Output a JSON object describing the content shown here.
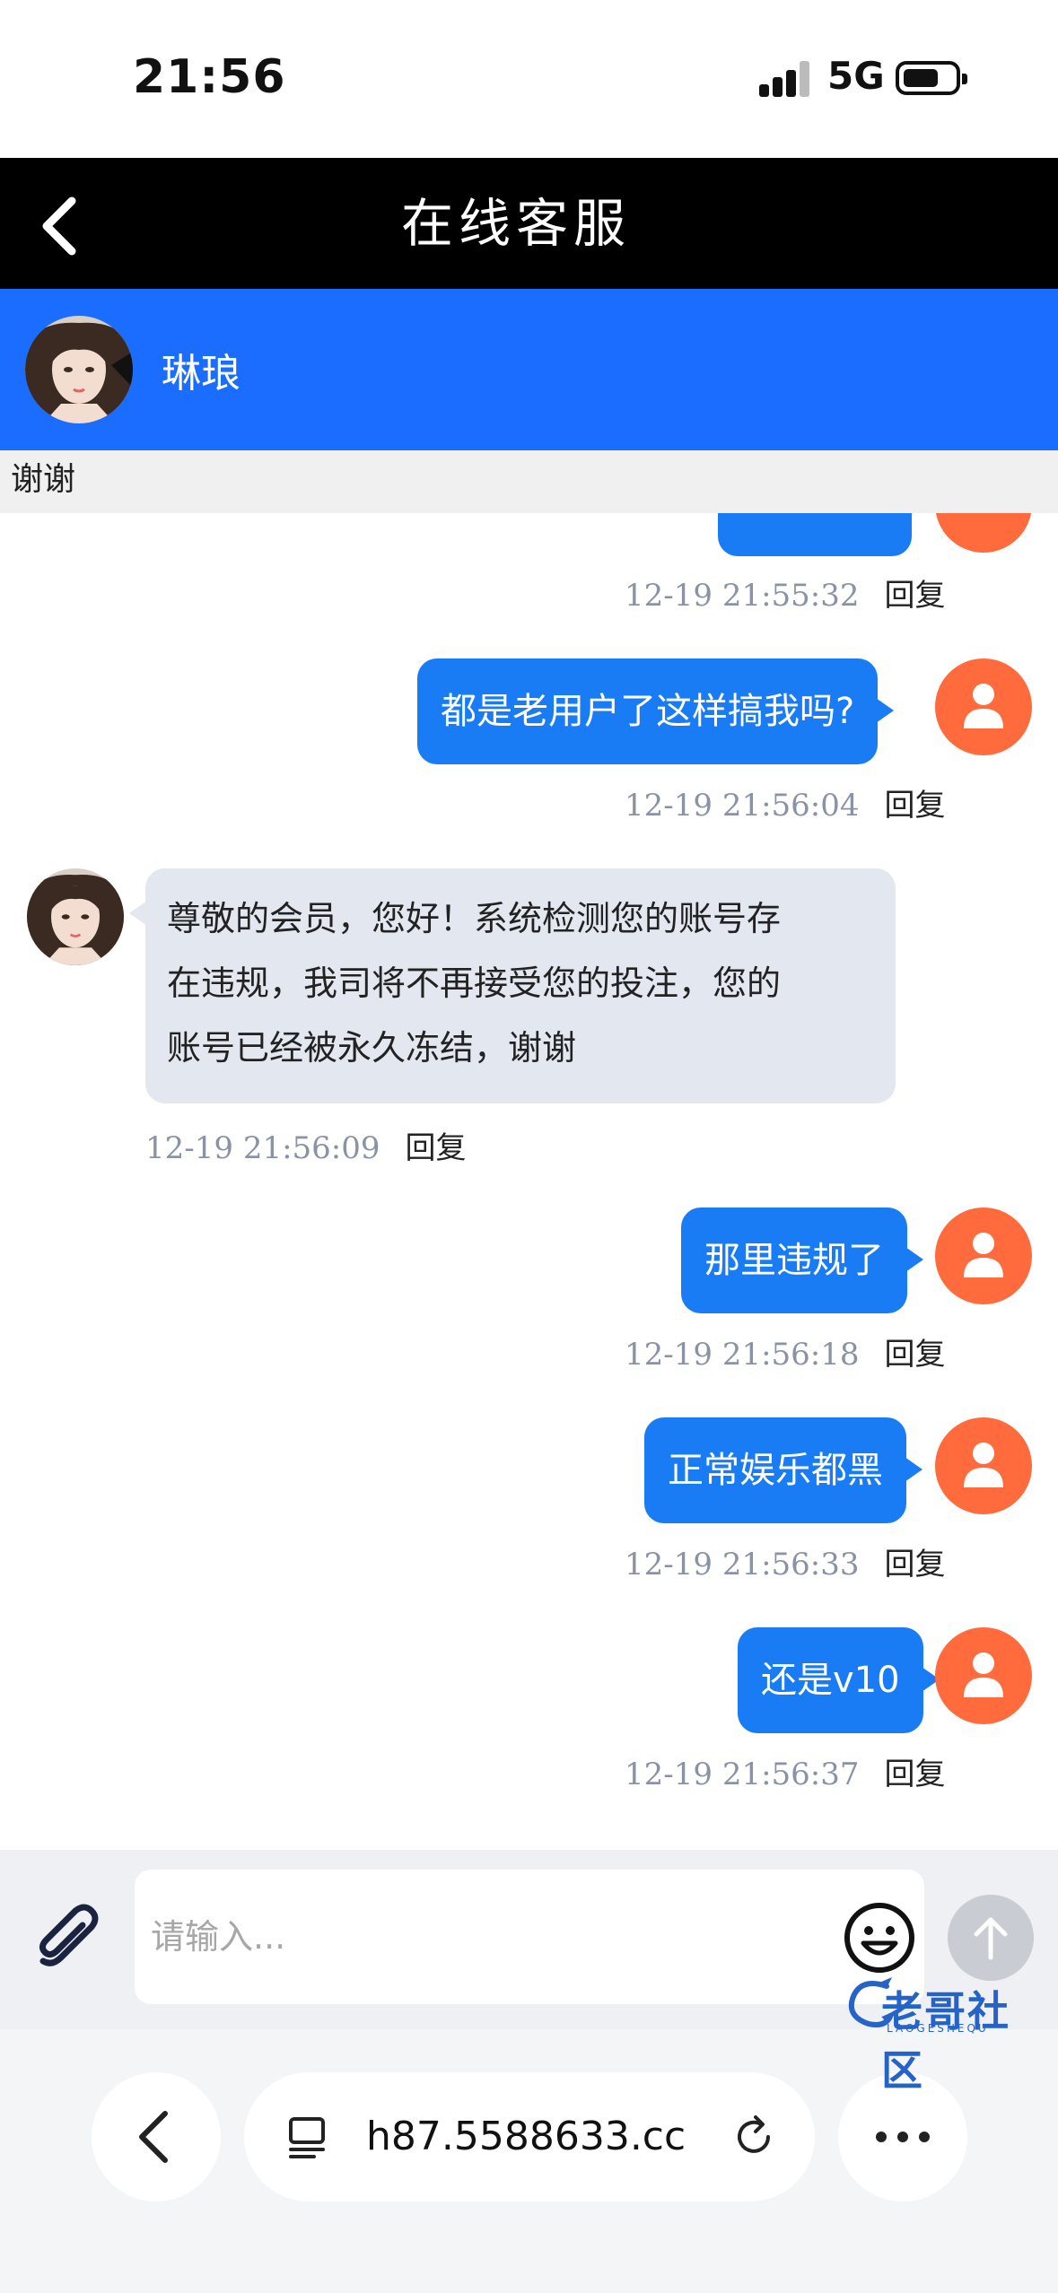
{
  "status": {
    "time": "21:56",
    "network": "5G"
  },
  "header": {
    "title": "在线客服"
  },
  "agent": {
    "name": "琳琅"
  },
  "notice": "谢谢",
  "messages": [
    {
      "side": "right",
      "text": "",
      "time": "12-19 21:55:32",
      "reply": "回复"
    },
    {
      "side": "right",
      "text": "都是老用户了这样搞我吗?",
      "time": "12-19 21:56:04",
      "reply": "回复"
    },
    {
      "side": "left",
      "lines": [
        "尊敬的会员，您好！系统检测您的账号存",
        "在违规，我司将不再接受您的投注，您的",
        "账号已经被永久冻结，谢谢"
      ],
      "time": "12-19 21:56:09",
      "reply": "回复"
    },
    {
      "side": "right",
      "text": "那里违规了",
      "time": "12-19 21:56:18",
      "reply": "回复"
    },
    {
      "side": "right",
      "text": "正常娱乐都黑",
      "time": "12-19 21:56:33",
      "reply": "回复"
    },
    {
      "side": "right",
      "text": "还是v10",
      "time": "12-19 21:56:37",
      "reply": "回复"
    }
  ],
  "input": {
    "placeholder": "请输入..."
  },
  "browser": {
    "url": "h87.5588633.cc"
  },
  "watermark": {
    "text": "老哥社区",
    "sub": "LAOGESHEQU"
  },
  "colors": {
    "header_bg": "#000000",
    "agent_bar": "#1a6dff",
    "bubble_right": "#1a7cf5",
    "bubble_left": "#e3e8f0",
    "user_avatar": "#ff6b3d"
  }
}
